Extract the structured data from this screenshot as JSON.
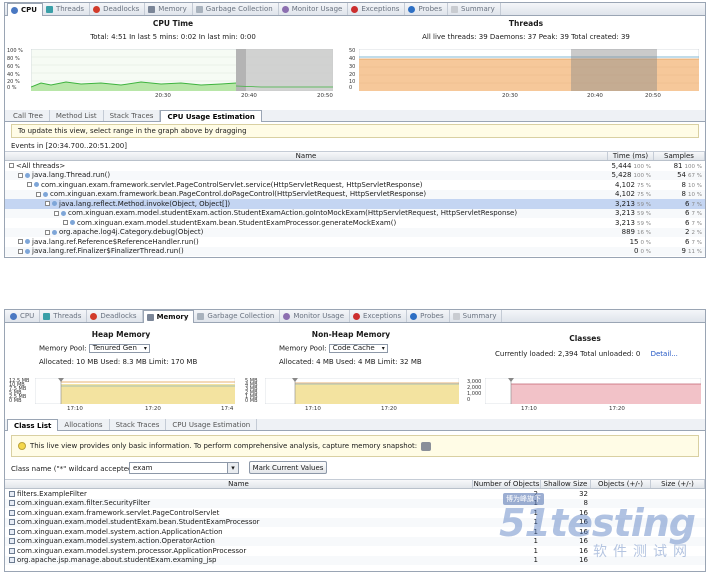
{
  "colors": {
    "accent": "#4a78c2",
    "cpu_line": "#3fb33f",
    "threads_fill": "#f6c89a",
    "selection": "#c4d5f2",
    "heap_fill": "#f3e3a0",
    "nonheap_fill": "#f3e3a0",
    "classes_fill": "#f2c2c8"
  },
  "tabs": [
    {
      "label": "CPU",
      "icon": "cpu-icon"
    },
    {
      "label": "Threads",
      "icon": "threads-icon"
    },
    {
      "label": "Deadlocks",
      "icon": "deadlocks-icon"
    },
    {
      "label": "Memory",
      "icon": "memory-icon"
    },
    {
      "label": "Garbage Collection",
      "icon": "gc-icon"
    },
    {
      "label": "Monitor Usage",
      "icon": "monitor-icon"
    },
    {
      "label": "Exceptions",
      "icon": "exceptions-icon"
    },
    {
      "label": "Probes",
      "icon": "probes-icon"
    },
    {
      "label": "Summary",
      "icon": "summary-icon"
    }
  ],
  "cpu": {
    "title": "CPU Time",
    "stats": "Total: 4:51   In last 5 mins: 0:02   In last min: 0:00",
    "y_ticks": [
      "100 %",
      "80 %",
      "60 %",
      "40 %",
      "20 %",
      "0 %"
    ],
    "x_ticks": [
      "20:30",
      "20:40",
      "20:50"
    ],
    "chart_data": {
      "type": "area",
      "x": [
        "20:30",
        "20:40",
        "20:50"
      ],
      "ylim": [
        0,
        100
      ]
    }
  },
  "threads": {
    "title": "Threads",
    "stats": "All live threads: 39   Daemons: 37   Peak: 39   Total created: 39",
    "y_ticks": [
      "50",
      "40",
      "30",
      "20",
      "10",
      "0"
    ],
    "x_ticks": [
      "20:30",
      "20:40",
      "20:50"
    ],
    "chart_data": {
      "type": "area",
      "x": [
        "20:30",
        "20:40",
        "20:50"
      ],
      "ylim": [
        0,
        50
      ]
    }
  },
  "cpu_subtabs": [
    "Call Tree",
    "Method List",
    "Stack Traces",
    "CPU Usage Estimation"
  ],
  "cpu_info": "To update this view, select range in the graph above by dragging",
  "events_label": "Events in [20:34.700..20:51.200]",
  "cpu_table": {
    "headers": [
      "Name",
      "Time (ms)",
      "Samples"
    ],
    "rows": [
      {
        "name": "<All threads>",
        "time": "5,444",
        "tpct": "100 %",
        "samples": "81",
        "spct": "100 %",
        "level": 0,
        "sel": false
      },
      {
        "name": "java.lang.Thread.run()",
        "time": "5,428",
        "tpct": "100 %",
        "samples": "54",
        "spct": "67 %",
        "level": 1,
        "sel": false
      },
      {
        "name": "com.xinguan.exam.framework.servlet.PageControlServlet.service(HttpServletRequest, HttpServletResponse)",
        "time": "4,102",
        "tpct": "75 %",
        "samples": "8",
        "spct": "10 %",
        "level": 2,
        "sel": false
      },
      {
        "name": "com.xinguan.exam.framework.bean.PageControl.doPageControl(HttpServletRequest, HttpServletResponse)",
        "time": "4,102",
        "tpct": "75 %",
        "samples": "8",
        "spct": "10 %",
        "level": 3,
        "sel": false
      },
      {
        "name": "java.lang.reflect.Method.invoke(Object, Object[])",
        "time": "3,213",
        "tpct": "59 %",
        "samples": "6",
        "spct": "7 %",
        "level": 4,
        "sel": true
      },
      {
        "name": "com.xinguan.exam.model.studentExam.action.StudentExamAction.goIntoMockExam(HttpServletRequest, HttpServletResponse)",
        "time": "3,213",
        "tpct": "59 %",
        "samples": "6",
        "spct": "7 %",
        "level": 5,
        "sel": false
      },
      {
        "name": "com.xinguan.exam.model.studentExam.bean.StudentExamProcessor.generateMockExam()",
        "time": "3,213",
        "tpct": "59 %",
        "samples": "6",
        "spct": "7 %",
        "level": 6,
        "sel": false
      },
      {
        "name": "org.apache.log4j.Category.debug(Object)",
        "time": "889",
        "tpct": "16 %",
        "samples": "2",
        "spct": "2 %",
        "level": 4,
        "sel": false
      },
      {
        "name": "java.lang.ref.Reference$ReferenceHandler.run()",
        "time": "15",
        "tpct": "0 %",
        "samples": "6",
        "spct": "7 %",
        "level": 1,
        "sel": false
      },
      {
        "name": "java.lang.ref.Finalizer$FinalizerThread.run()",
        "time": "0",
        "tpct": "0 %",
        "samples": "9",
        "spct": "11 %",
        "level": 1,
        "sel": false
      }
    ]
  },
  "heap": {
    "title": "Heap Memory",
    "pool_label": "Memory Pool:",
    "pool_value": "Tenured Gen",
    "stats": "Allocated:  10 MB   Used:  8.3 MB   Limit:  170 MB",
    "y_ticks": [
      "12.5 MB",
      "10 MB",
      "7.5 MB",
      "5 MB",
      "2.5 MB",
      "0 MB"
    ],
    "x_ticks": [
      "17:10",
      "17:20",
      "17:4"
    ]
  },
  "nonheap": {
    "title": "Non-Heap Memory",
    "pool_label": "Memory Pool:",
    "pool_value": "Code Cache",
    "stats": "Allocated:  4 MB   Used:  4 MB   Limit:  32 MB",
    "y_ticks": [
      "5 MB",
      "4 MB",
      "3 MB",
      "2 MB",
      "1 MB",
      "0 MB"
    ],
    "x_ticks": [
      "17:10",
      "17:20"
    ]
  },
  "classes": {
    "title": "Classes",
    "stats": "Currently loaded:  2,394    Total unloaded:  0",
    "details": "Detail...",
    "y_ticks": [
      "3,000",
      "2,000",
      "1,000",
      "0"
    ],
    "x_ticks": [
      "17:10",
      "17:20"
    ]
  },
  "mem_subtabs": [
    "Class List",
    "Allocations",
    "Stack Traces",
    "CPU Usage Estimation"
  ],
  "mem_info": "This live view provides only basic information. To perform comprehensive analysis, capture memory snapshot:",
  "filter": {
    "label": "Class name (\"*\" wildcard accepted):",
    "value": "exam",
    "button": "Mark Current Values"
  },
  "class_table": {
    "headers": [
      "Name",
      "Number of Objects",
      "Shallow Size",
      "Objects (+/-)",
      "Size (+/-)"
    ],
    "rows": [
      {
        "name": "filters.ExampleFilter",
        "objects": "2",
        "size": "32"
      },
      {
        "name": "com.xinguan.exam.filter.SecurityFilter",
        "objects": "1",
        "size": "8"
      },
      {
        "name": "com.xinguan.exam.framework.servlet.PageControlServlet",
        "objects": "1",
        "size": "16"
      },
      {
        "name": "com.xinguan.exam.model.studentExam.bean.StudentExamProcessor",
        "objects": "1",
        "size": "16"
      },
      {
        "name": "com.xinguan.exam.model.system.action.ApplicationAction",
        "objects": "1",
        "size": "16"
      },
      {
        "name": "com.xinguan.exam.model.system.action.OperatorAction",
        "objects": "1",
        "size": "16"
      },
      {
        "name": "com.xinguan.exam.model.system.processor.ApplicationProcessor",
        "objects": "1",
        "size": "16"
      },
      {
        "name": "org.apache.jsp.manage.about.studentExam.examing_jsp",
        "objects": "1",
        "size": "16"
      }
    ]
  },
  "watermark": {
    "brand": "51testing",
    "cn": "软件测试网",
    "badge": "博为峰旗下"
  }
}
